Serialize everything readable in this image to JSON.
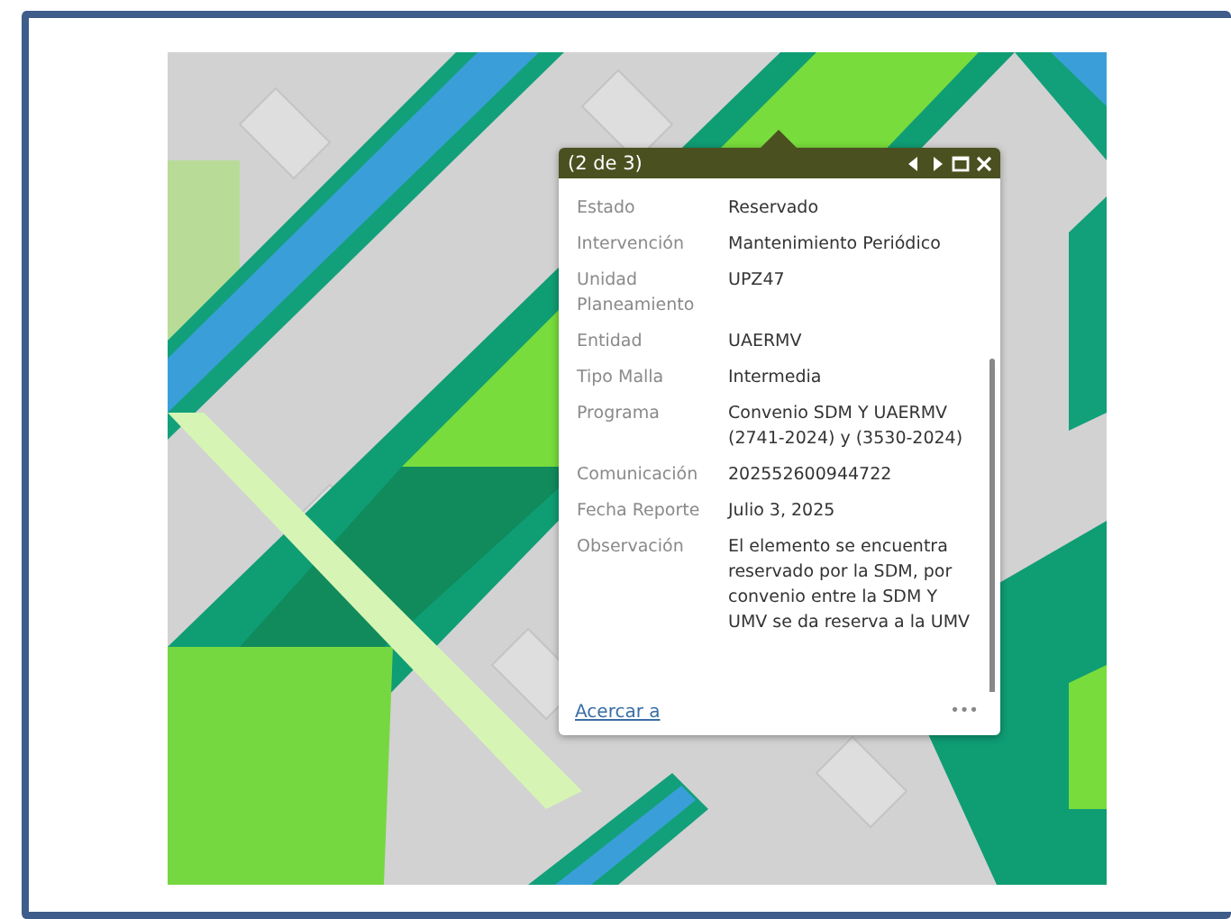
{
  "popup": {
    "counter": "(2 de 3)",
    "fields": [
      {
        "label": "Estado",
        "value": "Reservado"
      },
      {
        "label": "Intervención",
        "value": "Mantenimiento Periódico"
      },
      {
        "label": "Unidad Planeamiento",
        "value": "UPZ47"
      },
      {
        "label": "Entidad",
        "value": "UAERMV"
      },
      {
        "label": "Tipo Malla",
        "value": "Intermedia"
      },
      {
        "label": "Programa",
        "value": "Convenio SDM Y UAERMV (2741-2024) y (3530-2024)"
      },
      {
        "label": "Comunicación",
        "value": "202552600944722"
      },
      {
        "label": "Fecha Reporte",
        "value": "Julio 3, 2025"
      },
      {
        "label": "Observación",
        "value": "El elemento se encuentra reservado por la SDM, por convenio entre la SDM Y UMV se da reserva a la UMV"
      }
    ],
    "zoom_link": "Acercar a",
    "more": "•••"
  }
}
